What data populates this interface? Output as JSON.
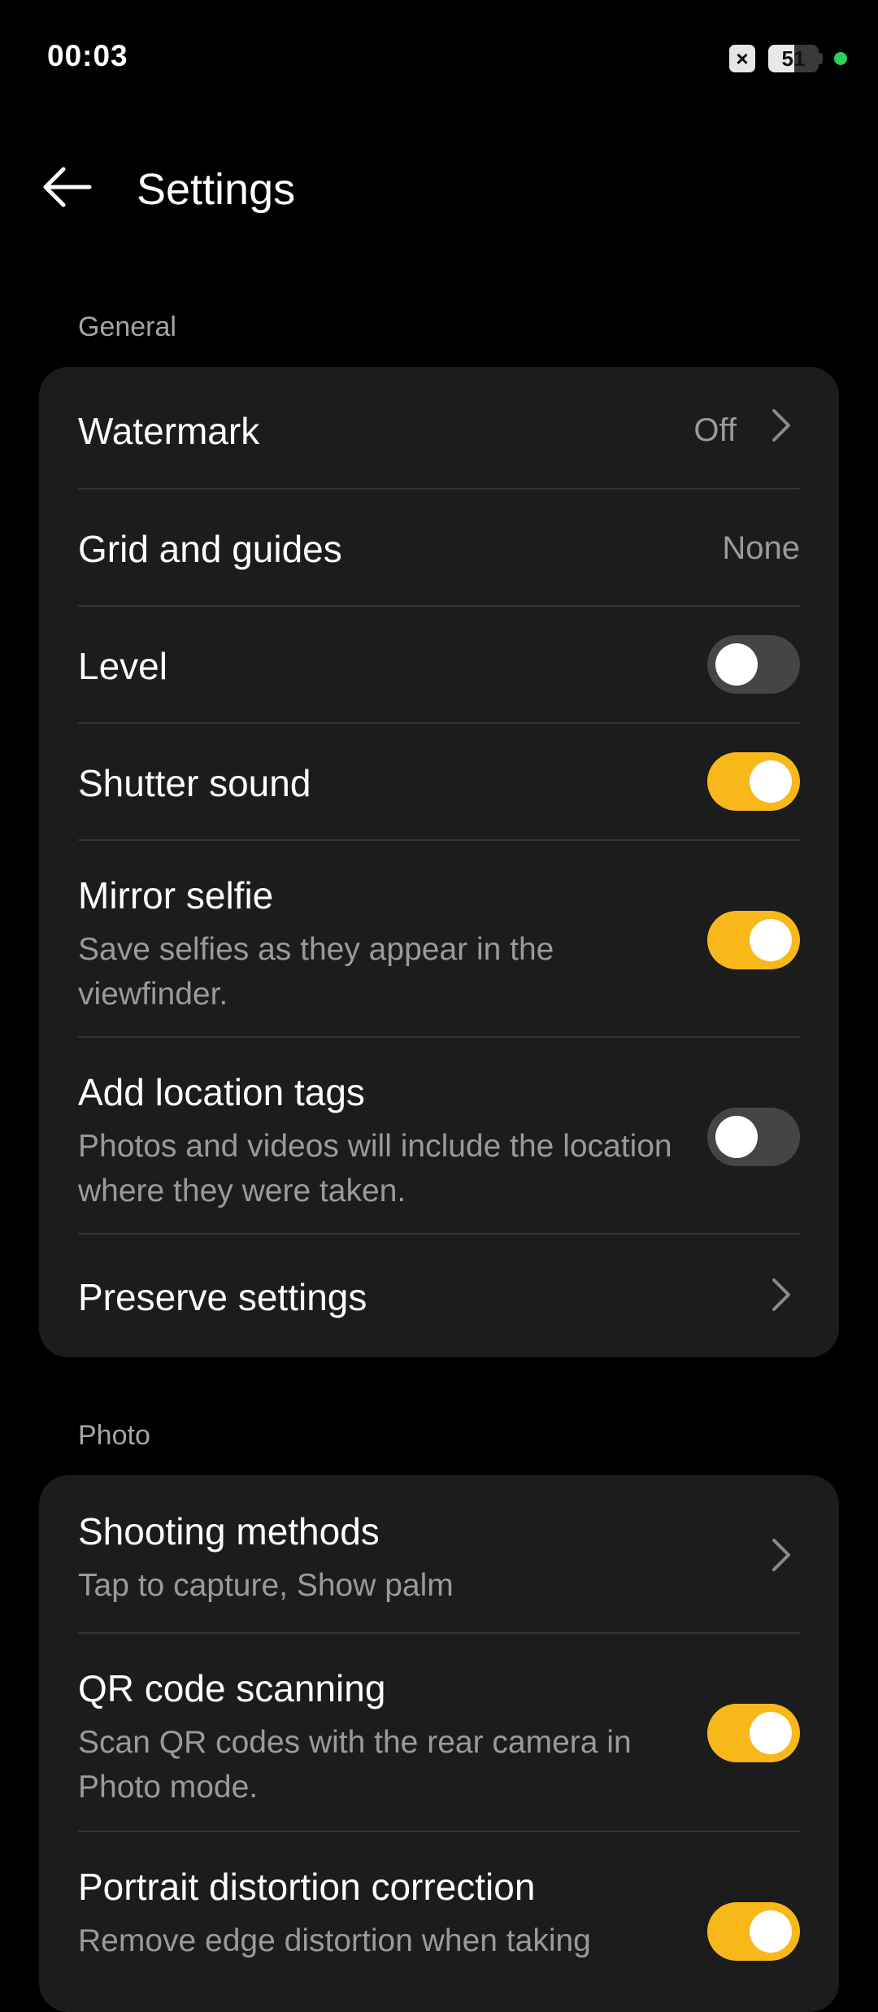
{
  "status_bar": {
    "time": "00:03",
    "battery_level": "51",
    "battery_fraction": 0.51,
    "icons": [
      "notification-x-icon",
      "battery-icon",
      "privacy-dot-icon"
    ]
  },
  "header": {
    "title": "Settings",
    "back_icon": "arrow-left-icon"
  },
  "sections": {
    "general": {
      "label": "General",
      "items": {
        "watermark": {
          "title": "Watermark",
          "value": "Off"
        },
        "grid": {
          "title": "Grid and guides",
          "value": "None"
        },
        "level": {
          "title": "Level",
          "enabled": false
        },
        "shutter": {
          "title": "Shutter sound",
          "enabled": true
        },
        "mirror": {
          "title": "Mirror selfie",
          "subtitle": "Save selfies as they appear in the viewfinder.",
          "enabled": true
        },
        "location": {
          "title": "Add location tags",
          "subtitle": "Photos and videos will include the location where they were taken.",
          "enabled": false
        },
        "preserve": {
          "title": "Preserve settings"
        }
      }
    },
    "photo": {
      "label": "Photo",
      "items": {
        "shooting": {
          "title": "Shooting methods",
          "subtitle": "Tap to capture, Show palm"
        },
        "qr": {
          "title": "QR code scanning",
          "subtitle": "Scan QR codes with the rear camera in Photo mode.",
          "enabled": true
        },
        "portrait": {
          "title": "Portrait distortion correction",
          "subtitle": "Remove edge distortion when taking",
          "enabled": true
        }
      }
    }
  },
  "colors": {
    "background": "#000000",
    "card": "#1c1c1c",
    "accent": "#f9b819",
    "toggle_off": "#454545",
    "secondary_text": "#9a9a9a",
    "status_dot": "#2ed158"
  }
}
